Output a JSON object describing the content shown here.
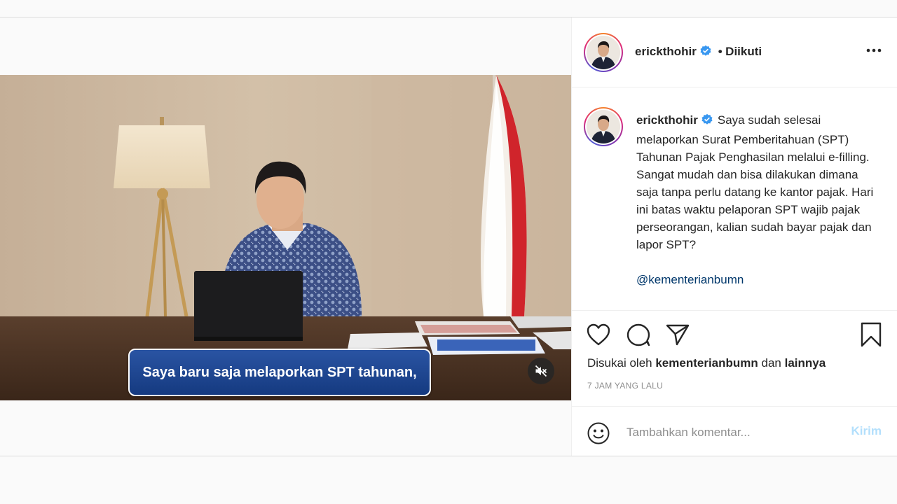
{
  "post": {
    "username": "erickthohir",
    "follow_status": "Diikuti",
    "separator": "•"
  },
  "video": {
    "subtitle": "Saya baru saja melaporkan SPT tahunan,",
    "muted": true
  },
  "caption": {
    "username": "erickthohir",
    "text": "Saya sudah selesai melaporkan Surat Pemberitahuan (SPT) Tahunan Pajak Penghasilan melalui e-filling. Sangat mudah dan bisa dilakukan dimana saja tanpa perlu datang ke kantor pajak. Hari ini batas waktu pelaporan SPT wajib pajak perseorangan, kalian sudah bayar pajak dan lapor SPT?",
    "mention": "@kementerianbumn"
  },
  "engagement": {
    "liked_by_prefix": "Disukai oleh",
    "liked_by_user": "kementerianbumn",
    "liked_by_conj": "dan",
    "liked_by_others": "lainnya",
    "timestamp": "7 JAM YANG LALU"
  },
  "comment": {
    "placeholder": "Tambahkan komentar...",
    "send_label": "Kirim"
  },
  "icons": {
    "like": "heart-icon",
    "comment": "comment-icon",
    "share": "paper-plane-icon",
    "save": "bookmark-icon",
    "emoji": "smiley-icon",
    "mute": "speaker-muted-icon",
    "verified": "verified-badge-icon",
    "more": "ellipsis-icon"
  },
  "colors": {
    "verified": "#3897f0",
    "link": "#00376b",
    "send_disabled": "#b2dffc",
    "subtitle_bg": "#1d4691"
  }
}
